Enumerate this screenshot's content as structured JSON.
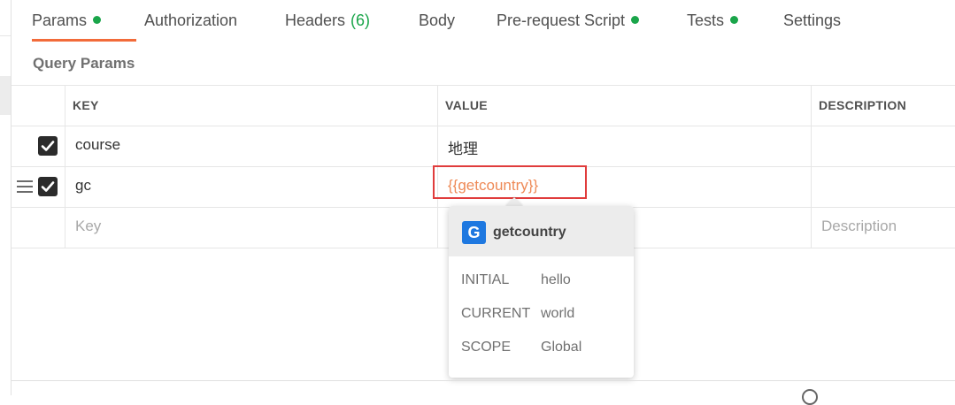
{
  "tabs": [
    {
      "label": "Params",
      "dot": true
    },
    {
      "label": "Authorization"
    },
    {
      "label": "Headers",
      "count": "(6)"
    },
    {
      "label": "Body"
    },
    {
      "label": "Pre-request Script",
      "dot": true
    },
    {
      "label": "Tests",
      "dot": true
    },
    {
      "label": "Settings"
    }
  ],
  "colors": {
    "active_tab_underline": "#f26b3a",
    "status_dot": "#1aa54a",
    "variable_text": "#ee8a57",
    "highlight_box": "#e03c3c",
    "badge": "#1e78e0"
  },
  "section_title": "Query Params",
  "table": {
    "headers": {
      "key": "KEY",
      "value": "VALUE",
      "description": "DESCRIPTION"
    },
    "rows": [
      {
        "checked": true,
        "key": "course",
        "value": "地理",
        "description": ""
      },
      {
        "checked": true,
        "key": "gc",
        "value": "{{getcountry}}",
        "description": ""
      }
    ],
    "new_row": {
      "key_placeholder": "Key",
      "description_placeholder": "Description"
    }
  },
  "popup": {
    "badge": "G",
    "name": "getcountry",
    "rows": [
      {
        "label": "INITIAL",
        "value": "hello"
      },
      {
        "label": "CURRENT",
        "value": "world"
      },
      {
        "label": "SCOPE",
        "value": "Global"
      }
    ]
  }
}
